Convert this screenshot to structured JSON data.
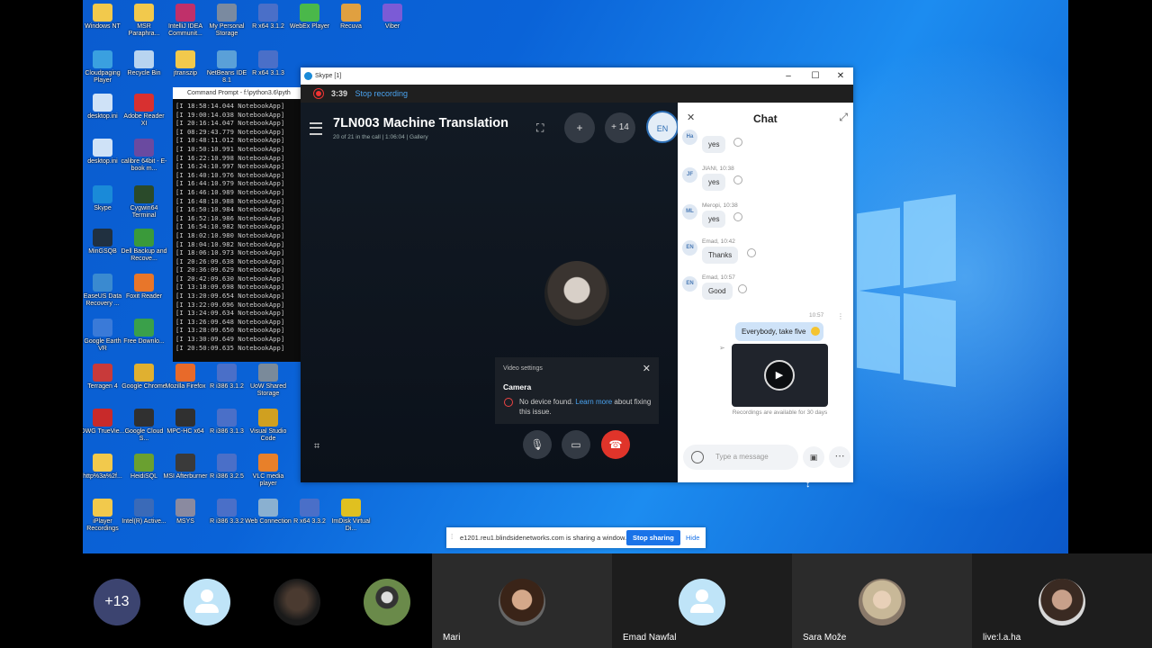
{
  "desktop": {
    "icons": [
      {
        "label": "Windows NT",
        "color": "#f2c94c"
      },
      {
        "label": "MSR Paraphra...",
        "color": "#f2c94c"
      },
      {
        "label": "IntelliJ IDEA Communit...",
        "color": "#c0306a"
      },
      {
        "label": "My Personal Storage",
        "color": "#7a8aa0"
      },
      {
        "label": "R x64 3.1.2",
        "color": "#4a6fc8"
      },
      {
        "label": "WebEx Player",
        "color": "#4ab84a"
      },
      {
        "label": "Recuva",
        "color": "#e0a040"
      },
      {
        "label": "Viber",
        "color": "#7b5bd6"
      },
      {
        "label": "Cloudpaging Player",
        "color": "#3aa0e0"
      },
      {
        "label": "Recycle Bin",
        "color": "#b8d4f0"
      },
      {
        "label": "jtranszip",
        "color": "#f2c94c"
      },
      {
        "label": "NetBeans IDE 8.1",
        "color": "#5aa0d8"
      },
      {
        "label": "R x64 3.1.3",
        "color": "#4a6fc8"
      },
      {
        "label": "desktop.ini",
        "color": "#cfe2f7"
      },
      {
        "label": "Adobe Reader XI",
        "color": "#d83030"
      },
      {
        "label": "desktop.ini",
        "color": "#cfe2f7"
      },
      {
        "label": "calibre 64bit - E-book m...",
        "color": "#6a4aa0"
      },
      {
        "label": "Skype",
        "color": "#1a8ad8"
      },
      {
        "label": "Cygwin64 Terminal",
        "color": "#2a4a2a"
      },
      {
        "label": "MinGSQB",
        "color": "#203040"
      },
      {
        "label": "Dell Backup and Recove...",
        "color": "#3a9a3a"
      },
      {
        "label": "EaseUS Data Recovery ...",
        "color": "#3a8ad0"
      },
      {
        "label": "Foxit Reader",
        "color": "#e8762a"
      },
      {
        "label": "Google Earth VR",
        "color": "#3a7ad8"
      },
      {
        "label": "Free Downlo...",
        "color": "#3aa04a"
      },
      {
        "label": "Terragen 4",
        "color": "#c83a3a"
      },
      {
        "label": "Google Chrome",
        "color": "#e0b030"
      },
      {
        "label": "Mozilla Firefox",
        "color": "#e86a2a"
      },
      {
        "label": "R i386 3.1.2",
        "color": "#4a6fc8"
      },
      {
        "label": "UoW Shared Storage",
        "color": "#7a8a9a"
      },
      {
        "label": "DWG TrueVie...",
        "color": "#c82a2a"
      },
      {
        "label": "Google Cloud S...",
        "color": "#303030"
      },
      {
        "label": "MPC-HC x64",
        "color": "#303030"
      },
      {
        "label": "R i386 3.1.3",
        "color": "#4a6fc8"
      },
      {
        "label": "Visual Studio Code",
        "color": "#d0a020"
      },
      {
        "label": "http%3a%2f...",
        "color": "#f2c94c"
      },
      {
        "label": "HeidiSQL",
        "color": "#6aa030"
      },
      {
        "label": "MSI Afterburner",
        "color": "#3a3a3a"
      },
      {
        "label": "R i386 3.2.5",
        "color": "#4a6fc8"
      },
      {
        "label": "VLC media player",
        "color": "#e8802a"
      },
      {
        "label": "iPlayer Recordings",
        "color": "#f2c94c"
      },
      {
        "label": "Intel(R) Active...",
        "color": "#3a6ab8"
      },
      {
        "label": "MSYS",
        "color": "#8a8aa0"
      },
      {
        "label": "R i386 3.3.2",
        "color": "#4a6fc8"
      },
      {
        "label": "Web Connection",
        "color": "#8ab0d0"
      },
      {
        "label": "R x64 3.3.2",
        "color": "#4a6fc8"
      },
      {
        "label": "ImDisk Virtual Di...",
        "color": "#e0c020"
      }
    ]
  },
  "cmd": {
    "title": "Command Prompt - f:\\python3.6\\pyth",
    "lines": [
      "[I 18:58:14.044 NotebookApp]",
      "[I 19:00:14.038 NotebookApp]",
      "[I 20:16:14.047 NotebookApp]",
      "[I 08:29:43.779 NotebookApp]",
      "[I 10:48:11.012 NotebookApp]",
      "[I 10:50:10.991 NotebookApp]",
      "[I 16:22:10.998 NotebookApp]",
      "[I 16:24:10.997 NotebookApp]",
      "[I 16:40:10.976 NotebookApp]",
      "[I 16:44:10.979 NotebookApp]",
      "[I 16:46:10.989 NotebookApp]",
      "[I 16:48:10.988 NotebookApp]",
      "[I 16:50:10.984 NotebookApp]",
      "[I 16:52:10.986 NotebookApp]",
      "[I 16:54:10.982 NotebookApp]",
      "[I 18:02:10.980 NotebookApp]",
      "[I 18:04:10.982 NotebookApp]",
      "[I 18:06:10.973 NotebookApp]",
      "[I 20:26:09.638 NotebookApp]",
      "[I 20:36:09.629 NotebookApp]",
      "[I 20:42:09.630 NotebookApp]",
      "[I 13:18:09.698 NotebookApp]",
      "[I 13:20:09.654 NotebookApp]",
      "[I 13:22:09.696 NotebookApp]",
      "[I 13:24:09.634 NotebookApp]",
      "[I 13:26:09.648 NotebookApp]",
      "[I 13:28:09.650 NotebookApp]",
      "[I 13:30:09.649 NotebookApp]",
      "[I 20:50:09.635 NotebookApp]"
    ]
  },
  "skype": {
    "window_title": "Skype [1]",
    "rec_time": "3:39",
    "stop_recording": "Stop recording",
    "call_title": "7LN003 Machine Translation",
    "call_sub": "20 of 21 in the call | 1:06:04 | ",
    "gallery": "Gallery",
    "add_count": "+ 14",
    "my_initials": "EN",
    "video_settings": {
      "title": "Video settings",
      "camera": "Camera",
      "msg_a": "No device found. ",
      "link": "Learn more",
      "msg_b": " about fixing this issue."
    },
    "chat": {
      "title": "Chat",
      "messages": [
        {
          "initials": "Ha",
          "meta": "",
          "text": "yes"
        },
        {
          "initials": "JF",
          "meta": "JIANI, 10:38",
          "text": "yes"
        },
        {
          "initials": "ML",
          "meta": "Meropi, 10:38",
          "text": "yes"
        },
        {
          "initials": "EN",
          "meta": "Emad, 10:42",
          "text": "Thanks"
        },
        {
          "initials": "EN",
          "meta": "Emad, 10:57",
          "text": "Good"
        }
      ],
      "my_time": "10:57",
      "my_text": "Everybody, take five",
      "recordings_note": "Recordings are available for 30 days",
      "input_placeholder": "Type a message"
    }
  },
  "share_bar": {
    "text": "e1201.reu1.blindsidenetworks.com is sharing a window.",
    "stop": "Stop sharing",
    "hide": "Hide"
  },
  "participants": {
    "more_count": "+13",
    "named": [
      "Mari",
      "Emad Nawfal",
      "Sara Može",
      "live:l.a.ha"
    ]
  }
}
